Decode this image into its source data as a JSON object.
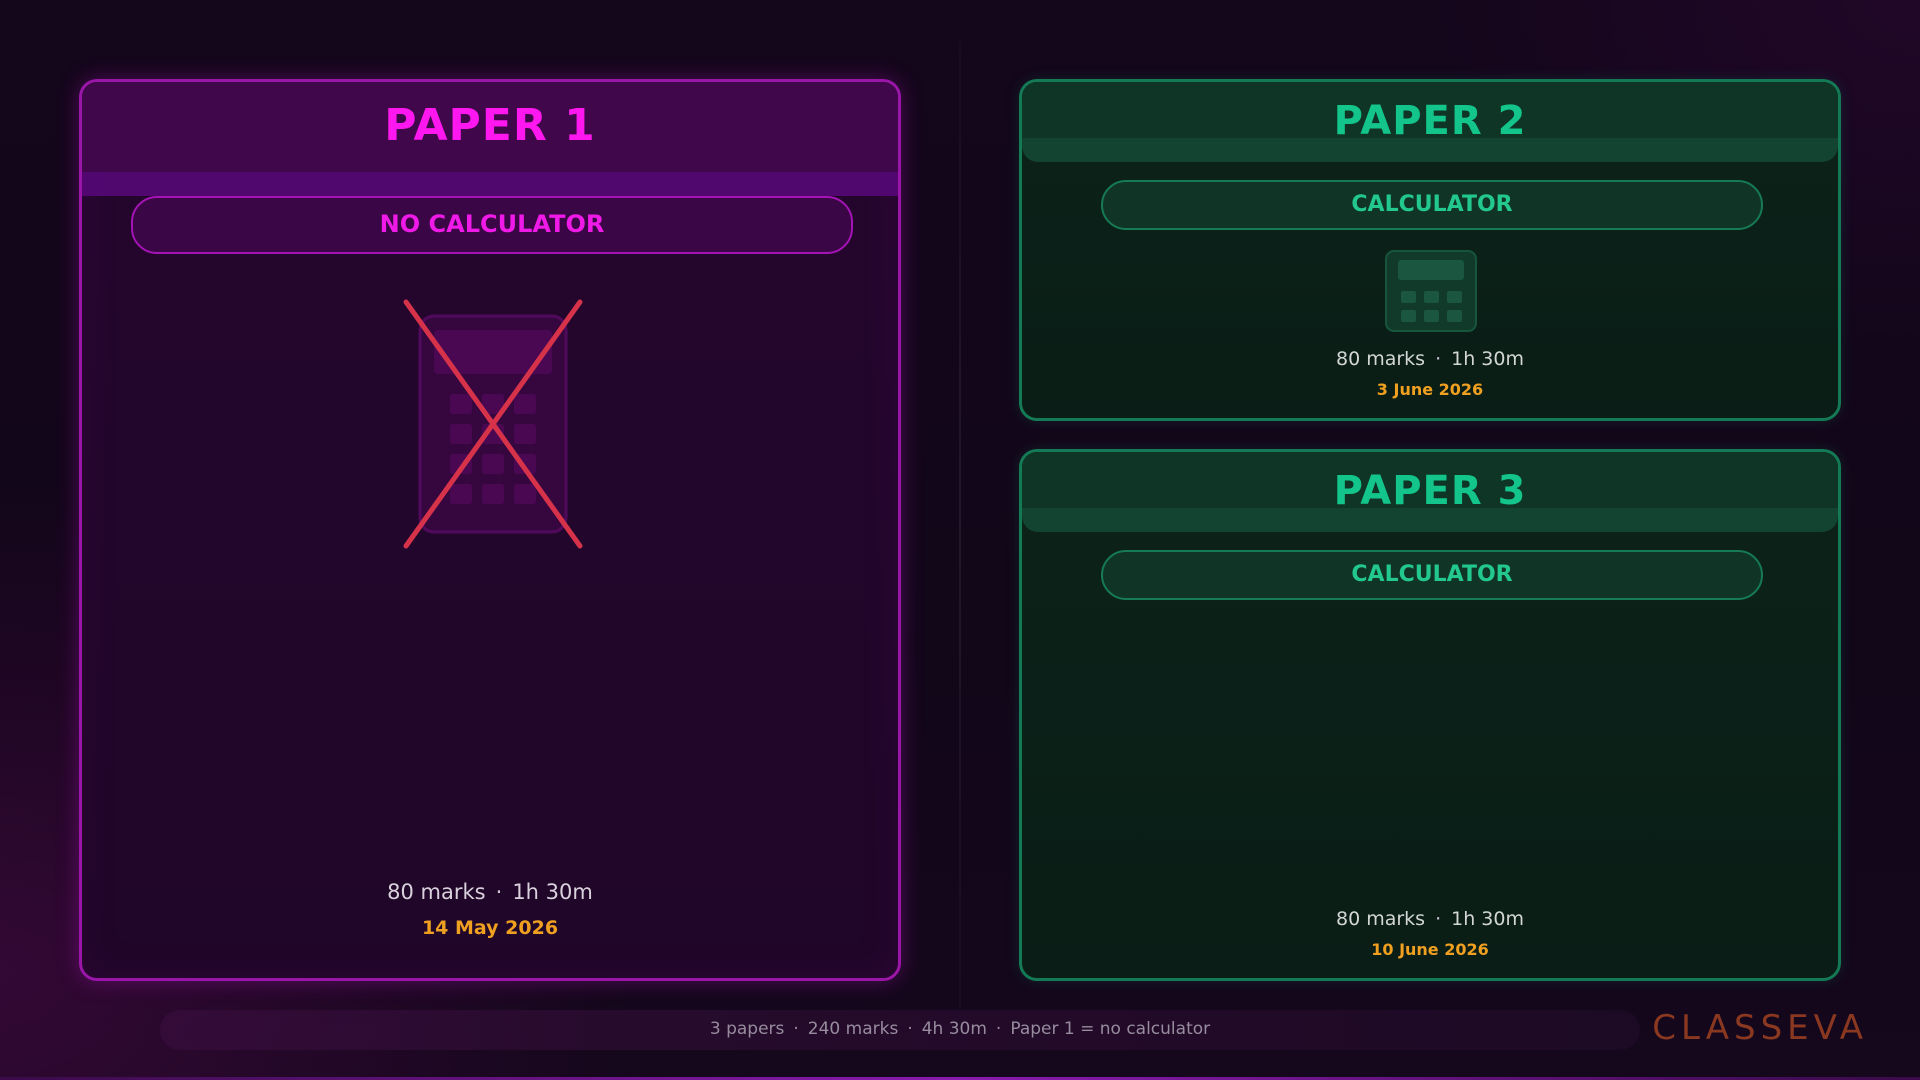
{
  "papers": [
    {
      "title": "PAPER 1",
      "calculator_label": "NO CALCULATOR",
      "marks": "80 marks",
      "duration": "1h 30m",
      "date": "14 May 2026",
      "calculator_allowed": false
    },
    {
      "title": "PAPER 2",
      "calculator_label": "CALCULATOR",
      "marks": "80 marks",
      "duration": "1h 30m",
      "date": "3 June 2026",
      "calculator_allowed": true
    },
    {
      "title": "PAPER 3",
      "calculator_label": "CALCULATOR",
      "marks": "80 marks",
      "duration": "1h 30m",
      "date": "10 June 2026",
      "calculator_allowed": true
    }
  ],
  "footer": {
    "items": [
      "3 papers",
      "240 marks",
      "4h 30m",
      "Paper 1 = no calculator"
    ],
    "brand": "CLASSEVA"
  },
  "separator": "·",
  "icons": {
    "no_calculator": "calculator-crossed-icon",
    "calculator": "calculator-icon"
  },
  "colors": {
    "paper1_accent": "#ff17ef",
    "calculator_accent": "#13c58a",
    "date": "#f0a020",
    "cross": "#d6334a",
    "brand": "#8a3820"
  }
}
